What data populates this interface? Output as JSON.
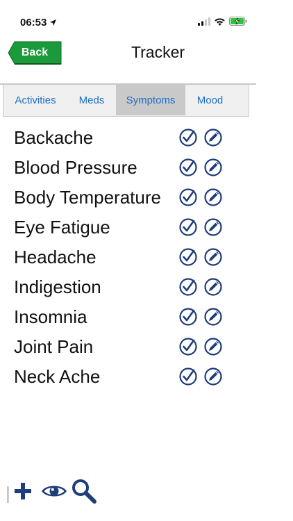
{
  "status_bar": {
    "time": "06:53",
    "icons": [
      "location-arrow-icon",
      "cellular-signal-icon",
      "wifi-icon",
      "battery-charging-icon"
    ]
  },
  "header": {
    "back_label": "Back",
    "title": "Tracker"
  },
  "tabs": [
    {
      "label": "Activities",
      "selected": false
    },
    {
      "label": "Meds",
      "selected": false
    },
    {
      "label": "Symptoms",
      "selected": true
    },
    {
      "label": "Mood",
      "selected": false
    }
  ],
  "symptoms": [
    {
      "label": "Backache"
    },
    {
      "label": "Blood Pressure"
    },
    {
      "label": "Body Temperature"
    },
    {
      "label": "Eye Fatigue"
    },
    {
      "label": "Headache"
    },
    {
      "label": "Indigestion"
    },
    {
      "label": "Insomnia"
    },
    {
      "label": "Joint Pain"
    },
    {
      "label": "Neck Ache"
    }
  ],
  "row_icons": [
    "check-circle-icon",
    "pencil-circle-icon"
  ],
  "toolbar": {
    "icons": [
      "plus-icon",
      "eye-icon",
      "magnifier-icon"
    ]
  },
  "colors": {
    "back_button": "#1a9a3a",
    "tab_text": "#1c6fc6",
    "tab_selected_bg": "#c9c9c9",
    "icon_navy": "#1f3d7a"
  }
}
